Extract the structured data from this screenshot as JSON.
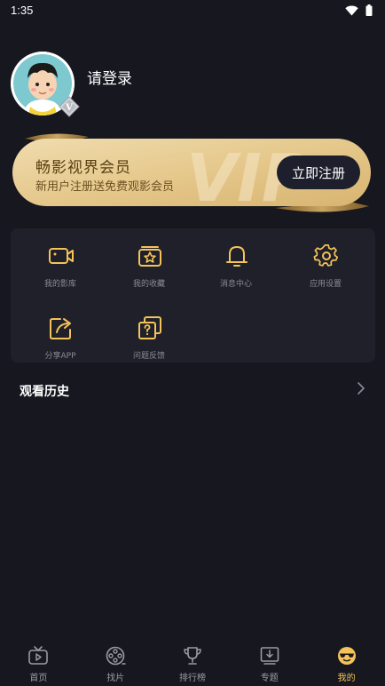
{
  "status_bar": {
    "time": "1:35"
  },
  "profile": {
    "login_text": "请登录",
    "badge_letter": "V"
  },
  "vip_banner": {
    "title": "畅影视界会员",
    "subtitle": "新用户注册送免费观影会员",
    "button_label": "立即注册",
    "watermark": "VIP"
  },
  "menu": {
    "items": [
      {
        "label": "我的影库",
        "icon": "film-camera-icon"
      },
      {
        "label": "我的收藏",
        "icon": "favorites-star-icon"
      },
      {
        "label": "消息中心",
        "icon": "bell-icon"
      },
      {
        "label": "应用设置",
        "icon": "gear-icon"
      },
      {
        "label": "分享APP",
        "icon": "share-icon"
      },
      {
        "label": "问题反馈",
        "icon": "feedback-question-icon"
      }
    ]
  },
  "history": {
    "title": "观看历史"
  },
  "tabbar": {
    "items": [
      {
        "label": "首页",
        "icon": "tv-icon"
      },
      {
        "label": "找片",
        "icon": "film-reel-icon"
      },
      {
        "label": "排行榜",
        "icon": "trophy-icon"
      },
      {
        "label": "专题",
        "icon": "topic-download-icon"
      },
      {
        "label": "我的",
        "icon": "smiley-sunglasses-icon"
      }
    ],
    "active_index": 4
  },
  "colors": {
    "accent": "#f4c35a",
    "background": "#16171f",
    "card": "#1f2029",
    "gold": "#e9cf97"
  }
}
